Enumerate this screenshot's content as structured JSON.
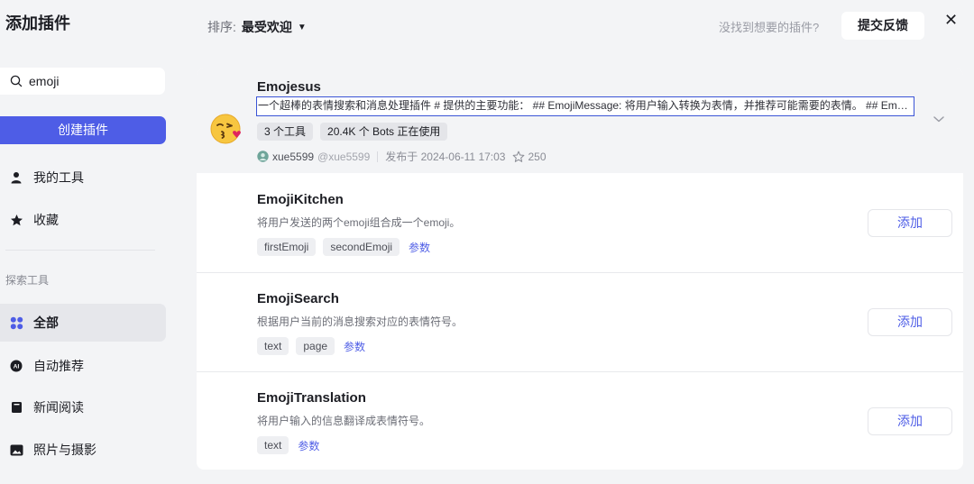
{
  "sidebar": {
    "title": "添加插件",
    "search": {
      "value": "emoji",
      "placeholder": ""
    },
    "create_button": "创建插件",
    "items": [
      {
        "label": "我的工具",
        "icon": "person-icon"
      },
      {
        "label": "收藏",
        "icon": "star-icon"
      }
    ],
    "section_label": "探索工具",
    "explore": [
      {
        "label": "全部",
        "icon": "grid-icon",
        "active": true
      },
      {
        "label": "自动推荐",
        "icon": "ai-icon"
      },
      {
        "label": "新闻阅读",
        "icon": "book-icon"
      },
      {
        "label": "照片与摄影",
        "icon": "image-icon"
      }
    ]
  },
  "header": {
    "sort_label": "排序:",
    "sort_value": "最受欢迎",
    "not_found": "没找到想要的插件?",
    "feedback_button": "提交反馈"
  },
  "plugin": {
    "name": "Emojesus",
    "description": "一个超棒的表情搜索和消息处理插件 # 提供的主要功能： ## EmojiMessage: 将用户输入转换为表情，并推荐可能需要的表情。 ## EmojiSearch: 根据用户输入搜索相关表情",
    "tags": [
      "3 个工具",
      "20.4K 个 Bots 正在使用"
    ],
    "author": "xue5599",
    "handle": "@xue5599",
    "published": "发布于 2024-06-11 17:03",
    "stars": "250"
  },
  "tools": [
    {
      "name": "EmojiKitchen",
      "description": "将用户发送的两个emoji组合成一个emoji。",
      "params": [
        "firstEmoji",
        "secondEmoji"
      ],
      "params_link": "参数",
      "add_label": "添加"
    },
    {
      "name": "EmojiSearch",
      "description": "根据用户当前的消息搜索对应的表情符号。",
      "params": [
        "text",
        "page"
      ],
      "params_link": "参数",
      "add_label": "添加"
    },
    {
      "name": "EmojiTranslation",
      "description": "将用户输入的信息翻译成表情符号。",
      "params": [
        "text"
      ],
      "params_link": "参数",
      "add_label": "添加"
    }
  ],
  "colors": {
    "accent": "#4e5de6",
    "background": "#f3f4f6",
    "panel": "#ffffff"
  }
}
